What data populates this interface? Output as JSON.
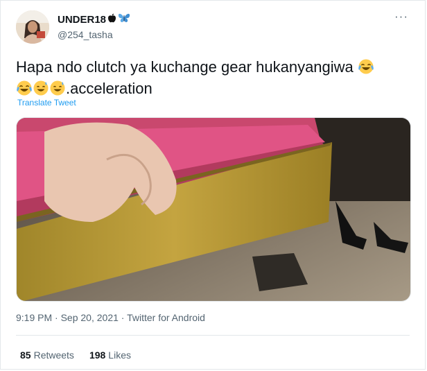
{
  "user": {
    "display_name": "UNDER18",
    "handle": "@254_tasha",
    "avatar_icon": "profile-photo",
    "name_emojis": [
      "apple-icon",
      "butterfly-icon"
    ]
  },
  "header": {
    "more_label": "···"
  },
  "tweet": {
    "line1": "Hapa ndo clutch ya kuchange gear hukanyangiwa",
    "line2_text": ".acceleration",
    "emojis": [
      "face-with-tears-of-joy",
      "face-with-tears-of-joy",
      "grinning-sweat-face",
      "grinning-sweat-face"
    ],
    "translate_label": "Translate Tweet"
  },
  "meta": {
    "time": "9:19 PM",
    "separator": "·",
    "date": "Sep 20, 2021",
    "source": "Twitter for Android"
  },
  "stats": {
    "retweets_count": "85",
    "retweets_label": "Retweets",
    "likes_count": "198",
    "likes_label": "Likes"
  },
  "colors": {
    "link": "#1d9bf0",
    "secondary_text": "#536471",
    "border": "#e3e7ea"
  }
}
